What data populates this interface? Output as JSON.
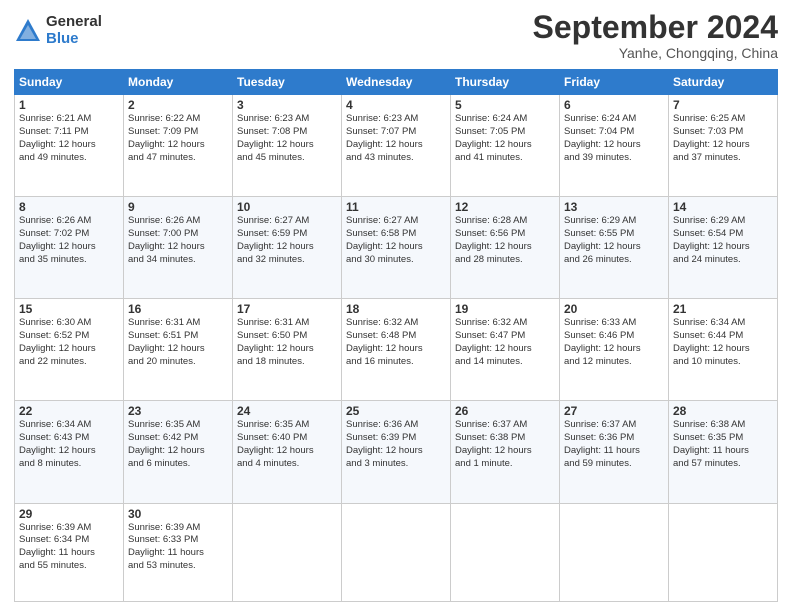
{
  "logo": {
    "general": "General",
    "blue": "Blue"
  },
  "title": "September 2024",
  "subtitle": "Yanhe, Chongqing, China",
  "headers": [
    "Sunday",
    "Monday",
    "Tuesday",
    "Wednesday",
    "Thursday",
    "Friday",
    "Saturday"
  ],
  "weeks": [
    [
      {
        "day": "1",
        "lines": [
          "Sunrise: 6:21 AM",
          "Sunset: 7:11 PM",
          "Daylight: 12 hours",
          "and 49 minutes."
        ]
      },
      {
        "day": "2",
        "lines": [
          "Sunrise: 6:22 AM",
          "Sunset: 7:09 PM",
          "Daylight: 12 hours",
          "and 47 minutes."
        ]
      },
      {
        "day": "3",
        "lines": [
          "Sunrise: 6:23 AM",
          "Sunset: 7:08 PM",
          "Daylight: 12 hours",
          "and 45 minutes."
        ]
      },
      {
        "day": "4",
        "lines": [
          "Sunrise: 6:23 AM",
          "Sunset: 7:07 PM",
          "Daylight: 12 hours",
          "and 43 minutes."
        ]
      },
      {
        "day": "5",
        "lines": [
          "Sunrise: 6:24 AM",
          "Sunset: 7:05 PM",
          "Daylight: 12 hours",
          "and 41 minutes."
        ]
      },
      {
        "day": "6",
        "lines": [
          "Sunrise: 6:24 AM",
          "Sunset: 7:04 PM",
          "Daylight: 12 hours",
          "and 39 minutes."
        ]
      },
      {
        "day": "7",
        "lines": [
          "Sunrise: 6:25 AM",
          "Sunset: 7:03 PM",
          "Daylight: 12 hours",
          "and 37 minutes."
        ]
      }
    ],
    [
      {
        "day": "8",
        "lines": [
          "Sunrise: 6:26 AM",
          "Sunset: 7:02 PM",
          "Daylight: 12 hours",
          "and 35 minutes."
        ]
      },
      {
        "day": "9",
        "lines": [
          "Sunrise: 6:26 AM",
          "Sunset: 7:00 PM",
          "Daylight: 12 hours",
          "and 34 minutes."
        ]
      },
      {
        "day": "10",
        "lines": [
          "Sunrise: 6:27 AM",
          "Sunset: 6:59 PM",
          "Daylight: 12 hours",
          "and 32 minutes."
        ]
      },
      {
        "day": "11",
        "lines": [
          "Sunrise: 6:27 AM",
          "Sunset: 6:58 PM",
          "Daylight: 12 hours",
          "and 30 minutes."
        ]
      },
      {
        "day": "12",
        "lines": [
          "Sunrise: 6:28 AM",
          "Sunset: 6:56 PM",
          "Daylight: 12 hours",
          "and 28 minutes."
        ]
      },
      {
        "day": "13",
        "lines": [
          "Sunrise: 6:29 AM",
          "Sunset: 6:55 PM",
          "Daylight: 12 hours",
          "and 26 minutes."
        ]
      },
      {
        "day": "14",
        "lines": [
          "Sunrise: 6:29 AM",
          "Sunset: 6:54 PM",
          "Daylight: 12 hours",
          "and 24 minutes."
        ]
      }
    ],
    [
      {
        "day": "15",
        "lines": [
          "Sunrise: 6:30 AM",
          "Sunset: 6:52 PM",
          "Daylight: 12 hours",
          "and 22 minutes."
        ]
      },
      {
        "day": "16",
        "lines": [
          "Sunrise: 6:31 AM",
          "Sunset: 6:51 PM",
          "Daylight: 12 hours",
          "and 20 minutes."
        ]
      },
      {
        "day": "17",
        "lines": [
          "Sunrise: 6:31 AM",
          "Sunset: 6:50 PM",
          "Daylight: 12 hours",
          "and 18 minutes."
        ]
      },
      {
        "day": "18",
        "lines": [
          "Sunrise: 6:32 AM",
          "Sunset: 6:48 PM",
          "Daylight: 12 hours",
          "and 16 minutes."
        ]
      },
      {
        "day": "19",
        "lines": [
          "Sunrise: 6:32 AM",
          "Sunset: 6:47 PM",
          "Daylight: 12 hours",
          "and 14 minutes."
        ]
      },
      {
        "day": "20",
        "lines": [
          "Sunrise: 6:33 AM",
          "Sunset: 6:46 PM",
          "Daylight: 12 hours",
          "and 12 minutes."
        ]
      },
      {
        "day": "21",
        "lines": [
          "Sunrise: 6:34 AM",
          "Sunset: 6:44 PM",
          "Daylight: 12 hours",
          "and 10 minutes."
        ]
      }
    ],
    [
      {
        "day": "22",
        "lines": [
          "Sunrise: 6:34 AM",
          "Sunset: 6:43 PM",
          "Daylight: 12 hours",
          "and 8 minutes."
        ]
      },
      {
        "day": "23",
        "lines": [
          "Sunrise: 6:35 AM",
          "Sunset: 6:42 PM",
          "Daylight: 12 hours",
          "and 6 minutes."
        ]
      },
      {
        "day": "24",
        "lines": [
          "Sunrise: 6:35 AM",
          "Sunset: 6:40 PM",
          "Daylight: 12 hours",
          "and 4 minutes."
        ]
      },
      {
        "day": "25",
        "lines": [
          "Sunrise: 6:36 AM",
          "Sunset: 6:39 PM",
          "Daylight: 12 hours",
          "and 3 minutes."
        ]
      },
      {
        "day": "26",
        "lines": [
          "Sunrise: 6:37 AM",
          "Sunset: 6:38 PM",
          "Daylight: 12 hours",
          "and 1 minute."
        ]
      },
      {
        "day": "27",
        "lines": [
          "Sunrise: 6:37 AM",
          "Sunset: 6:36 PM",
          "Daylight: 11 hours",
          "and 59 minutes."
        ]
      },
      {
        "day": "28",
        "lines": [
          "Sunrise: 6:38 AM",
          "Sunset: 6:35 PM",
          "Daylight: 11 hours",
          "and 57 minutes."
        ]
      }
    ],
    [
      {
        "day": "29",
        "lines": [
          "Sunrise: 6:39 AM",
          "Sunset: 6:34 PM",
          "Daylight: 11 hours",
          "and 55 minutes."
        ]
      },
      {
        "day": "30",
        "lines": [
          "Sunrise: 6:39 AM",
          "Sunset: 6:33 PM",
          "Daylight: 11 hours",
          "and 53 minutes."
        ]
      },
      {
        "day": "",
        "lines": []
      },
      {
        "day": "",
        "lines": []
      },
      {
        "day": "",
        "lines": []
      },
      {
        "day": "",
        "lines": []
      },
      {
        "day": "",
        "lines": []
      }
    ]
  ]
}
